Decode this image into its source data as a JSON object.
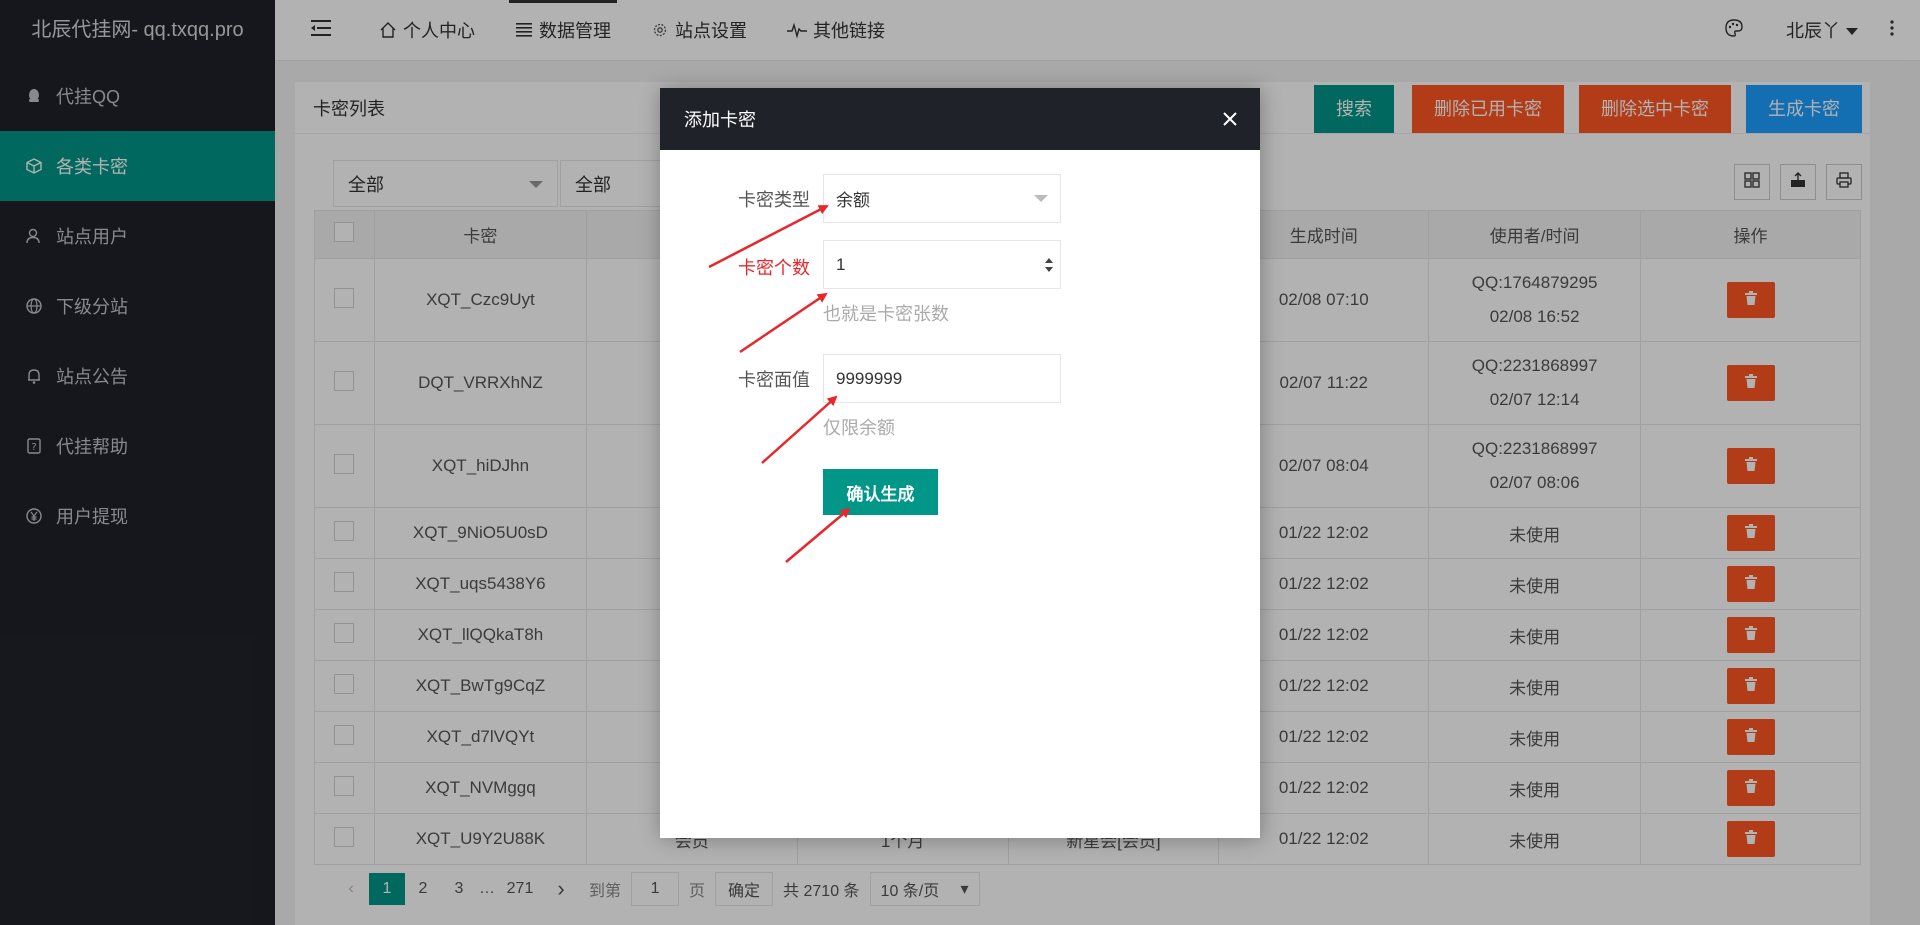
{
  "sidebar": {
    "logo": "北辰代挂网- qq.txqq.pro",
    "items": [
      {
        "label": "代挂QQ",
        "icon": "qq-icon"
      },
      {
        "label": "各类卡密",
        "icon": "box-icon"
      },
      {
        "label": "站点用户",
        "icon": "user-icon"
      },
      {
        "label": "下级分站",
        "icon": "globe-icon"
      },
      {
        "label": "站点公告",
        "icon": "bell-icon"
      },
      {
        "label": "代挂帮助",
        "icon": "help-icon"
      },
      {
        "label": "用户提现",
        "icon": "yen-icon"
      }
    ]
  },
  "header": {
    "tabs": [
      {
        "label": "个人中心",
        "icon": "home-icon"
      },
      {
        "label": "数据管理",
        "icon": "list-icon"
      },
      {
        "label": "站点设置",
        "icon": "gear-icon"
      },
      {
        "label": "其他链接",
        "icon": "pulse-icon"
      }
    ],
    "user": "北辰丫"
  },
  "card": {
    "title": "卡密列表",
    "buttons": {
      "search": "搜索",
      "delete_used": "删除已用卡密",
      "delete_selected": "删除选中卡密",
      "generate": "生成卡密"
    },
    "filters": [
      "全部",
      "全部"
    ]
  },
  "table": {
    "headers": [
      "卡密",
      "",
      "",
      "",
      "生成时间",
      "使用者/时间",
      "操作"
    ],
    "rows": [
      {
        "code": "XQT_Czc9Uyt",
        "c2": "",
        "c3": "",
        "c4": "",
        "time": "02/08 07:10",
        "user": "QQ:1764879295",
        "used": "02/08 16:52"
      },
      {
        "code": "DQT_VRRXhNZ",
        "c2": "",
        "c3": "",
        "c4": "",
        "time": "02/07 11:22",
        "user": "QQ:2231868997",
        "used": "02/07 12:14"
      },
      {
        "code": "XQT_hiDJhn",
        "c2": "",
        "c3": "",
        "c4": "",
        "time": "02/07 08:04",
        "user": "QQ:2231868997",
        "used": "02/07 08:06"
      },
      {
        "code": "XQT_9NiO5U0sD",
        "c2": "",
        "c3": "",
        "c4": "",
        "time": "01/22 12:02",
        "user": "未使用",
        "used": ""
      },
      {
        "code": "XQT_uqs5438Y6",
        "c2": "",
        "c3": "",
        "c4": "",
        "time": "01/22 12:02",
        "user": "未使用",
        "used": ""
      },
      {
        "code": "XQT_llQQkaT8h",
        "c2": "",
        "c3": "",
        "c4": "",
        "time": "01/22 12:02",
        "user": "未使用",
        "used": ""
      },
      {
        "code": "XQT_BwTg9CqZ",
        "c2": "",
        "c3": "",
        "c4": "",
        "time": "01/22 12:02",
        "user": "未使用",
        "used": ""
      },
      {
        "code": "XQT_d7lVQYt",
        "c2": "",
        "c3": "",
        "c4": "",
        "time": "01/22 12:02",
        "user": "未使用",
        "used": ""
      },
      {
        "code": "XQT_NVMggq",
        "c2": "",
        "c3": "",
        "c4": "",
        "time": "01/22 12:02",
        "user": "未使用",
        "used": ""
      },
      {
        "code": "XQT_U9Y2U88K",
        "c2": "会员",
        "c3": "1个月",
        "c4": "新星会[会员]",
        "time": "01/22 12:02",
        "user": "未使用",
        "used": ""
      }
    ]
  },
  "pager": {
    "pages": [
      "1",
      "2",
      "3",
      "…",
      "271"
    ],
    "goto_label": "到第",
    "goto_value": "1",
    "page_unit": "页",
    "confirm": "确定",
    "total": "共 2710 条",
    "size": "10 条/页"
  },
  "modal": {
    "title": "添加卡密",
    "type_label": "卡密类型",
    "type_value": "余额",
    "count_label": "卡密个数",
    "count_value": "1",
    "count_hint": "也就是卡密张数",
    "value_label": "卡密面值",
    "value_value": "9999999",
    "value_hint": "仅限余额",
    "submit": "确认生成"
  },
  "colors": {
    "accent": "#009688",
    "danger": "#ff5722",
    "sidebar": "#20222a",
    "primary": "#1e9fff",
    "arrow": "#e8262c"
  }
}
